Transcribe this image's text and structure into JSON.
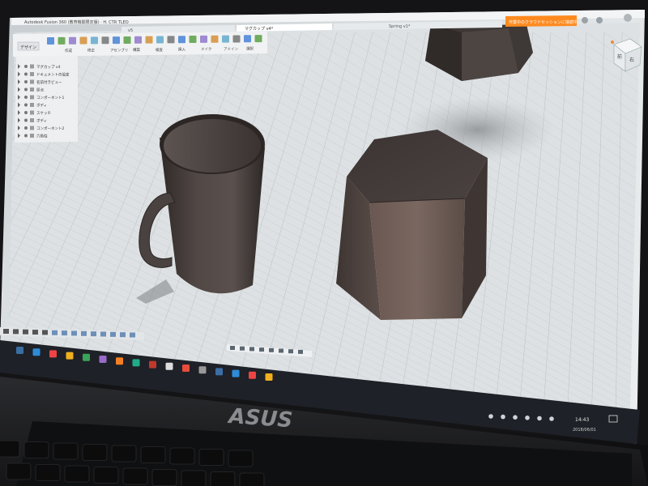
{
  "window": {
    "title": "Autodesk Fusion 360 (教育機関限定版) · H. CTR TLEO",
    "tab_active": "マグカップ v4*",
    "tab_other": "Spring v1*",
    "tab_small": "v5",
    "notice_banner": "作業中のクラウドセッションに接続中..."
  },
  "toolbar": {
    "workspace": "デザイン",
    "groups": [
      "作成",
      "修正",
      "アセンブリ",
      "構築",
      "検査",
      "挿入",
      "メイク",
      "アドイン",
      "選択"
    ]
  },
  "browser": {
    "items": [
      "マグカップ v4",
      "ドキュメントの設定",
      "名前付きビュー",
      "原点",
      "コンポーネント1",
      "ボディ",
      "スケッチ",
      "ボディ",
      "コンポーネント2",
      "六角柱"
    ]
  },
  "viewcube": {
    "face_front": "前",
    "face_right": "右"
  },
  "taskbar": {
    "time": "14:43",
    "date": "2018/06/01"
  },
  "laptop": {
    "brand": "ASUS"
  },
  "colors": {
    "viewport_bg": "#dde1e3",
    "grid_line": "#b9c0c4",
    "model_body": "#4a4340",
    "taskbar_bg": "#1e2127",
    "bezel": "#111214",
    "notice_banner": "#ff8a1f",
    "viewcube_accent": "#f08a3c"
  }
}
